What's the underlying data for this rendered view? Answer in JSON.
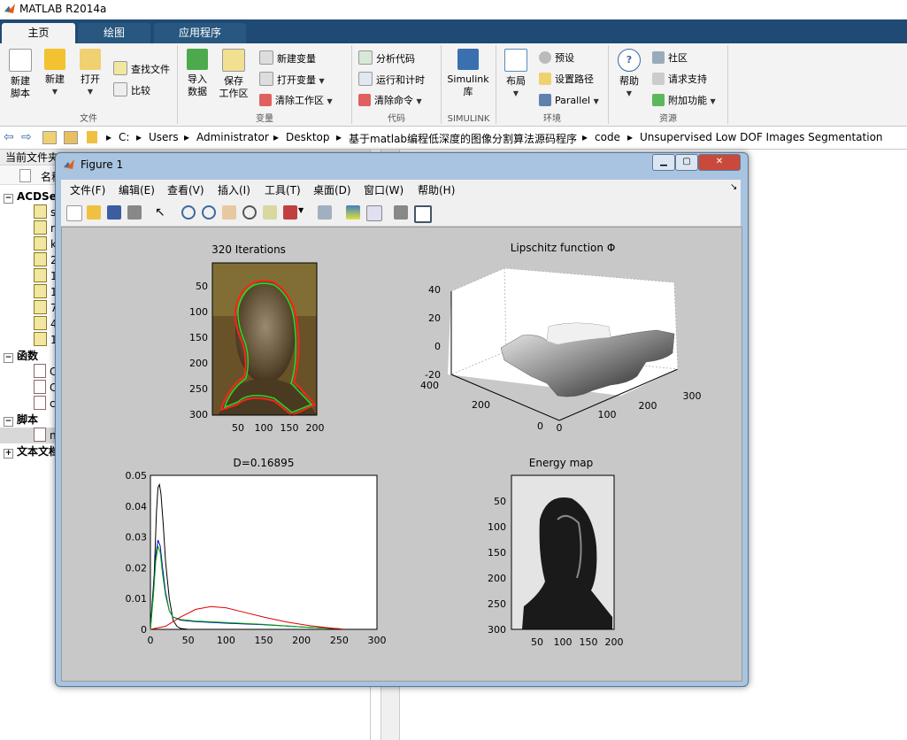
{
  "app": {
    "title": "MATLAB R2014a"
  },
  "ribbon_tabs": [
    "主页",
    "绘图",
    "应用程序"
  ],
  "ribbon": {
    "file": {
      "label": "文件",
      "new_script": "新建\n脚本",
      "new": "新建",
      "open": "打开",
      "find_files": "查找文件",
      "compare": "比较"
    },
    "variable": {
      "label": "变量",
      "import": "导入\n数据",
      "save_ws": "保存\n工作区",
      "new_var": "新建变量",
      "open_var": "打开变量",
      "clear_ws": "清除工作区"
    },
    "code": {
      "label": "代码",
      "analyze": "分析代码",
      "run_time": "运行和计时",
      "clear_cmd": "清除命令"
    },
    "simulink": {
      "label": "SIMULINK",
      "lib": "Simulink\n库"
    },
    "env": {
      "label": "环境",
      "layout": "布局",
      "prefs": "预设",
      "set_path": "设置路径",
      "parallel": "Parallel"
    },
    "resources": {
      "label": "资源",
      "help": "帮助",
      "community": "社区",
      "support": "请求支持",
      "addons": "附加功能"
    }
  },
  "address": {
    "segments": [
      "C:",
      "Users",
      "Administrator",
      "Desktop",
      "基于matlab编程低深度的图像分割算法源码程序",
      "code",
      "Unsupervised Low DOF Images Segmentation"
    ]
  },
  "left_panel": {
    "header": "当前文件夹",
    "col_name": "名称",
    "groups": [
      {
        "name": "ACDSee",
        "items": [
          "s",
          "n",
          "k",
          "2",
          "1",
          "1",
          "7",
          "4",
          "1"
        ]
      },
      {
        "name": "函数",
        "items": [
          "C",
          "C",
          "c"
        ]
      },
      {
        "name": "脚本",
        "items": [
          "n"
        ]
      },
      {
        "name": "文本文档",
        "items": []
      }
    ]
  },
  "figure": {
    "title": "Figure 1",
    "menu": [
      "文件(F)",
      "编辑(E)",
      "查看(V)",
      "插入(I)",
      "工具(T)",
      "桌面(D)",
      "窗口(W)",
      "帮助(H)"
    ],
    "plots": {
      "image1": {
        "title": "320 Iterations",
        "yticks": [
          "50",
          "100",
          "150",
          "200",
          "250",
          "300"
        ],
        "xticks": [
          "50",
          "100",
          "150",
          "200"
        ]
      },
      "surface": {
        "title": "Lipschitz function Φ",
        "zticks": [
          "40",
          "20",
          "0",
          "-20"
        ],
        "yticks": [
          "400",
          "200",
          "0"
        ],
        "xticks": [
          "0",
          "100",
          "200",
          "300"
        ]
      },
      "histogram": {
        "title": "D=0.16895"
      },
      "energy": {
        "title": "Energy map",
        "yticks": [
          "50",
          "100",
          "150",
          "200",
          "250",
          "300"
        ],
        "xticks": [
          "50",
          "100",
          "150",
          "200"
        ]
      }
    }
  },
  "chart_data": {
    "type": "line",
    "title": "D=0.16895",
    "xlim": [
      0,
      300
    ],
    "ylim": [
      0,
      0.05
    ],
    "xticks": [
      0,
      50,
      100,
      150,
      200,
      250,
      300
    ],
    "yticks": [
      0,
      0.01,
      0.02,
      0.03,
      0.04,
      0.05
    ],
    "ytick_labels": [
      "0",
      "0.01",
      "0.02",
      "0.03",
      "0.04",
      "0.05"
    ],
    "series": [
      {
        "color": "#000000",
        "x": [
          0,
          5,
          8,
          10,
          12,
          14,
          17,
          20,
          25,
          30,
          35,
          40,
          50,
          60,
          250
        ],
        "y": [
          0,
          0.018,
          0.038,
          0.046,
          0.047,
          0.044,
          0.034,
          0.022,
          0.01,
          0.003,
          0.001,
          0.0003,
          0,
          0,
          0
        ]
      },
      {
        "color": "#0000cc",
        "x": [
          0,
          4,
          7,
          10,
          13,
          16,
          20,
          25,
          30,
          40,
          60,
          100,
          150,
          200,
          250
        ],
        "y": [
          0,
          0.012,
          0.024,
          0.029,
          0.027,
          0.02,
          0.012,
          0.006,
          0.004,
          0.003,
          0.0025,
          0.002,
          0.0015,
          0.0008,
          0.0002
        ]
      },
      {
        "color": "#00aa00",
        "x": [
          0,
          4,
          7,
          10,
          13,
          16,
          20,
          25,
          30,
          40,
          60,
          100,
          150,
          200,
          250
        ],
        "y": [
          0,
          0.011,
          0.022,
          0.027,
          0.025,
          0.018,
          0.011,
          0.006,
          0.004,
          0.0032,
          0.0027,
          0.0022,
          0.0016,
          0.0008,
          0.0002
        ]
      },
      {
        "color": "#dd0000",
        "x": [
          0,
          20,
          40,
          60,
          80,
          100,
          120,
          150,
          180,
          210,
          240,
          255
        ],
        "y": [
          0,
          0.001,
          0.004,
          0.0065,
          0.0074,
          0.007,
          0.0058,
          0.004,
          0.0024,
          0.0012,
          0.0004,
          0.0001
        ]
      }
    ]
  },
  "colors": {
    "ribbon_dark": "#1f4a73",
    "figure_bg": "#c8c8c8",
    "frame": "#a8c4e0"
  }
}
